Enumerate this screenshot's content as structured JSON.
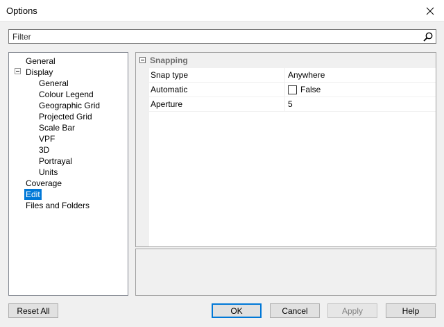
{
  "window": {
    "title": "Options"
  },
  "filter": {
    "placeholder": "Filter"
  },
  "tree": {
    "items": [
      {
        "label": "General",
        "level": 0
      },
      {
        "label": "Display",
        "level": 0,
        "expanded": true
      },
      {
        "label": "General",
        "level": 1
      },
      {
        "label": "Colour Legend",
        "level": 1
      },
      {
        "label": "Geographic Grid",
        "level": 1
      },
      {
        "label": "Projected Grid",
        "level": 1
      },
      {
        "label": "Scale Bar",
        "level": 1
      },
      {
        "label": "VPF",
        "level": 1
      },
      {
        "label": "3D",
        "level": 1
      },
      {
        "label": "Portrayal",
        "level": 1
      },
      {
        "label": "Units",
        "level": 1
      },
      {
        "label": "Coverage",
        "level": 0
      },
      {
        "label": "Edit",
        "level": 0,
        "selected": true
      },
      {
        "label": "Files and Folders",
        "level": 0
      }
    ]
  },
  "properties": {
    "category": "Snapping",
    "rows": [
      {
        "name": "Snap type",
        "value": "Anywhere"
      },
      {
        "name": "Automatic",
        "value": "False",
        "checkbox": true,
        "checked": false
      },
      {
        "name": "Aperture",
        "value": "5"
      }
    ]
  },
  "buttons": {
    "reset_all": "Reset All",
    "ok": "OK",
    "cancel": "Cancel",
    "apply": "Apply",
    "help": "Help"
  },
  "colors": {
    "selection": "#0078d7",
    "category_text": "#6d6d6d",
    "disabled_text": "#838383"
  }
}
